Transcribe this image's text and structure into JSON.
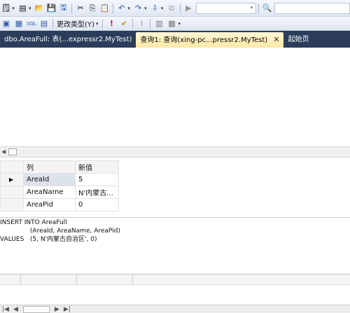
{
  "toolbar1": {
    "icons": [
      "new-query-icon",
      "add-item-icon",
      "open-file-icon",
      "save-icon",
      "save-all-icon",
      "cut-icon",
      "copy-icon",
      "paste-icon",
      "undo-icon",
      "redo-icon",
      "navigate-icon",
      "debug-icon",
      "play-icon",
      "solution-config-combo",
      "find-in-files-icon",
      "find-combo"
    ]
  },
  "toolbar2": {
    "change_type_label": "更改类型(Y)"
  },
  "tabs": [
    {
      "label": "dbo.AreaFull: 表(...expressr2.MyTest)",
      "active": false
    },
    {
      "label": "查询1: 查询(xing-pc...pressr2.MyTest)",
      "active": true,
      "close_glyph": "✕"
    },
    {
      "label": "起始页",
      "active": false
    }
  ],
  "criteria": {
    "headers": {
      "column": "列",
      "new_value": "新值"
    },
    "rows": [
      {
        "column": "AreaId",
        "value": "5",
        "current": true,
        "marker": "▶"
      },
      {
        "column": "AreaName",
        "value": "N'内蒙古...",
        "current": false,
        "marker": ""
      },
      {
        "column": "AreaPid",
        "value": "0",
        "current": false,
        "marker": ""
      }
    ]
  },
  "sql": {
    "line1": "INSERT INTO AreaFull",
    "line2": "               (AreaId, AreaName, AreaPid)",
    "line3": "VALUES   (5, N'内蒙古自治区', 0)"
  },
  "navbar": {
    "first": "|◀",
    "prev": "◀",
    "next": "▶",
    "last": "▶|"
  }
}
